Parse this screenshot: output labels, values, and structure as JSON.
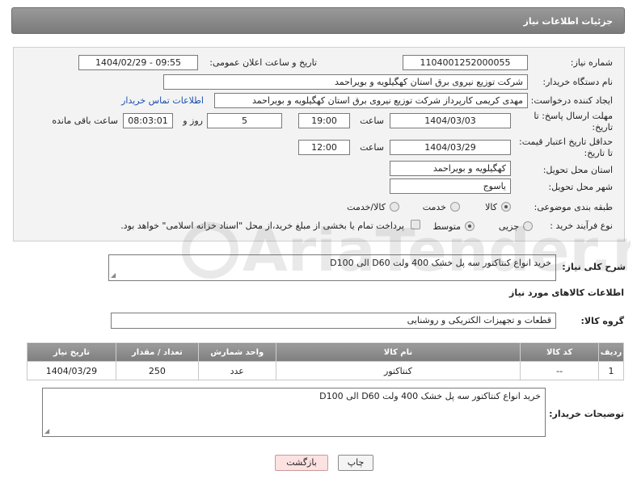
{
  "header": {
    "title": "جزئیات اطلاعات نیاز"
  },
  "form": {
    "need_number": {
      "label": "شماره نیاز:",
      "value": "1104001252000055"
    },
    "announce_datetime": {
      "label": "تاریخ و ساعت اعلان عمومی:",
      "value": "1404/02/29 - 09:55"
    },
    "buyer_org": {
      "label": "نام دستگاه خریدار:",
      "value": "شرکت توزیع نیروی برق استان کهگیلویه و بویراحمد"
    },
    "requester": {
      "label": "ایجاد کننده درخواست:",
      "value": "مهدی کریمی کارپرداز شرکت توزیع نیروی برق استان کهگیلویه و بویراحمد",
      "contact_link": "اطلاعات تماس خریدار"
    },
    "reply_deadline": {
      "label_line1": "مهلت ارسال پاسخ: تا",
      "label_line2": "تاریخ:",
      "date": "1404/03/03",
      "time_label": "ساعت",
      "time": "19:00",
      "days": "5",
      "days_label": "روز و",
      "remaining": "08:03:01",
      "remaining_label": "ساعت باقی مانده"
    },
    "price_validity": {
      "label_line1": "حداقل تاریخ اعتبار قیمت:",
      "label_line2": "تا تاریخ:",
      "date": "1404/03/29",
      "time_label": "ساعت",
      "time": "12:00"
    },
    "delivery_province": {
      "label": "استان محل تحویل:",
      "value": "کهگیلویه و بویراحمد"
    },
    "delivery_city": {
      "label": "شهر محل تحویل:",
      "value": "یاسوج"
    },
    "category": {
      "label": "طبقه بندی موضوعی:",
      "options": [
        "کالا",
        "خدمت",
        "کالا/خدمت"
      ],
      "selected": "کالا"
    },
    "purchase_process": {
      "label": "نوع فرآیند خرید :",
      "options": [
        "جزیی",
        "متوسط"
      ],
      "selected": "متوسط",
      "payment_note": "پرداخت تمام یا بخشی از مبلغ خرید،از محل \"اسناد خزانه اسلامی\" خواهد بود."
    }
  },
  "description": {
    "label": "شرح کلی نیاز:",
    "value": "خرید انواع کنتاکتور سه پل خشک 400 ولت D60 الی D100"
  },
  "goods_section": {
    "title": "اطلاعات کالاهای مورد نیاز"
  },
  "goods_group": {
    "label": "گروه کالا:",
    "value": "قطعات و تجهیزات الکتریکی و روشنایی"
  },
  "table": {
    "headers": [
      "ردیف",
      "کد کالا",
      "نام کالا",
      "واحد شمارش",
      "تعداد / مقدار",
      "تاریخ نیاز"
    ],
    "rows": [
      [
        "1",
        "--",
        "کنتاکتور",
        "عدد",
        "250",
        "1404/03/29"
      ]
    ]
  },
  "buyer_notes": {
    "label": "توضیحات خریدار:",
    "value": "خرید انواع کنتاکتور سه پل خشک 400 ولت D60 الی D100"
  },
  "buttons": {
    "print": "چاپ",
    "back": "بازگشت"
  },
  "watermark_text": "AriaTender.neT"
}
